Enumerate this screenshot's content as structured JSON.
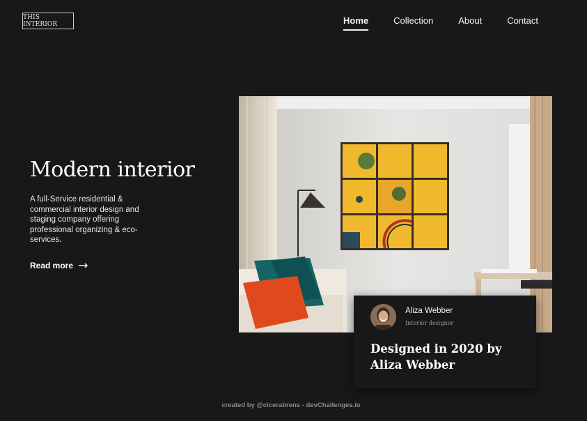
{
  "header": {
    "logo": "THIS INTERIOR",
    "nav": [
      {
        "label": "Home",
        "active": true
      },
      {
        "label": "Collection",
        "active": false
      },
      {
        "label": "About",
        "active": false
      },
      {
        "label": "Contact",
        "active": false
      }
    ]
  },
  "hero": {
    "title": "Modern interior",
    "description": "A full-Service residential & commercial interior design and staging company offering professional organizing & eco-services.",
    "cta_label": "Read more",
    "cta_icon": "arrow-right-icon"
  },
  "card": {
    "author_name": "Aliza Webber",
    "author_role": "Interior designer",
    "title": "Designed in 2020 by Aliza Webber"
  },
  "footer": {
    "credit": "created by @cicerabrens - devChallenges.io"
  },
  "colors": {
    "background": "#18181a",
    "text": "#f2f2f2",
    "muted": "#8c8c8c"
  }
}
